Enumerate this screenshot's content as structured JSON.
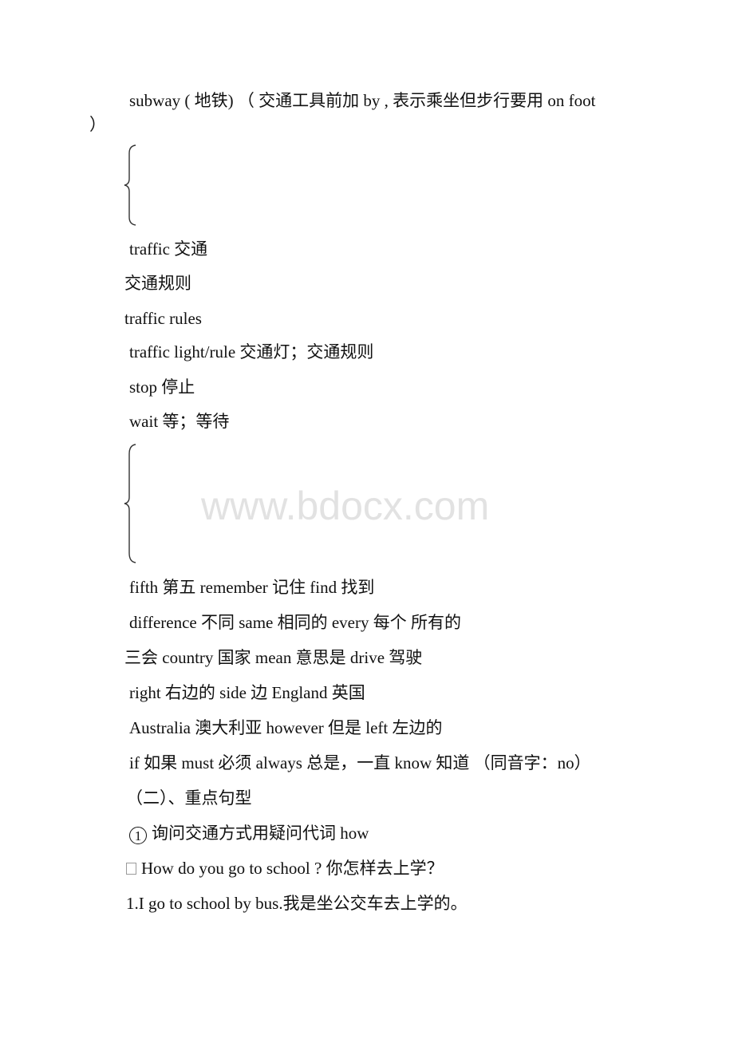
{
  "document": {
    "lines": [
      {
        "id": "subway",
        "text": "subway ( 地铁) （ 交通工具前加 by , 表示乘坐但步行要用 on foot"
      },
      {
        "id": "subway-close",
        "text": "）"
      },
      {
        "id": "traffic",
        "text": "traffic 交通"
      },
      {
        "id": "traffic-rules-cn",
        "text": "交通规则"
      },
      {
        "id": "traffic-rules-en",
        "text": "traffic rules"
      },
      {
        "id": "traffic-light",
        "text": "traffic light/rule 交通灯；交通规则"
      },
      {
        "id": "stop",
        "text": "stop 停止"
      },
      {
        "id": "wait",
        "text": "wait 等；等待"
      },
      {
        "id": "fifth",
        "text": "fifth 第五 remember 记住 find 找到"
      },
      {
        "id": "difference",
        "text": "difference 不同 same 相同的 every 每个 所有的"
      },
      {
        "id": "country",
        "text": "三会 country 国家 mean 意思是 drive 驾驶"
      },
      {
        "id": "right",
        "text": "right 右边的 side 边 England 英国"
      },
      {
        "id": "australia",
        "text": "Australia 澳大利亚 however 但是 left 左边的"
      },
      {
        "id": "if",
        "text": "if 如果 must 必须 always 总是，一直 know 知道 （同音字：no）"
      },
      {
        "id": "section-heading",
        "text": "（二）、重点句型"
      },
      {
        "id": "point-1",
        "marker": "1",
        "text": "询问交通方式用疑问代词 how"
      },
      {
        "id": "question",
        "marker_icon": "missing-glyph-box",
        "text": "How do you go to school ? 你怎样去上学？"
      },
      {
        "id": "answer-1",
        "text": "1.I go to school by bus.我是坐公交车去上学的。"
      }
    ]
  },
  "watermark": {
    "text": "www.bdocx.com",
    "color": "#e2e2e2"
  }
}
